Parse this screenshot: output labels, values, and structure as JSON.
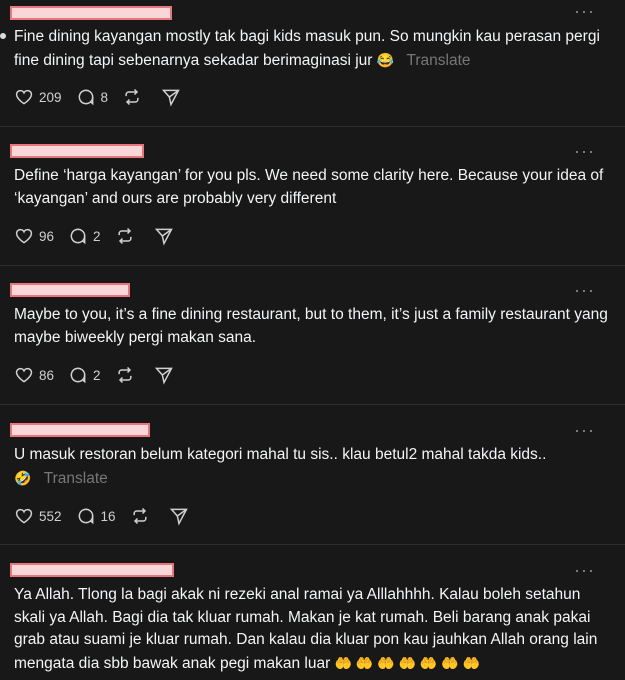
{
  "posts": [
    {
      "text": "Fine dining kayangan mostly tak bagi kids masuk pun. So mungkin kau perasan pergi fine dining tapi sebenarnya sekadar berimaginasi jur",
      "emoji": "😂",
      "translate": "Translate",
      "likes": "209",
      "replies": "8"
    },
    {
      "text": "Define ‘harga kayangan’ for you pls. We need some clarity here. Because your idea of ‘kayangan’ and ours are probably very different",
      "likes": "96",
      "replies": "2"
    },
    {
      "text": "Maybe to you, it’s a fine dining restaurant, but to them, it’s just a family restaurant yang maybe biweekly pergi makan sana.",
      "likes": "86",
      "replies": "2"
    },
    {
      "text": "U masuk restoran belum kategori mahal tu sis.. klau betul2 mahal takda kids..",
      "emoji": "🤣",
      "translate": "Translate",
      "likes": "552",
      "replies": "16"
    },
    {
      "text": "Ya Allah. Tlong la bagi akak ni rezeki anal ramai ya Alllahhhh. Kalau boleh setahun skali ya Allah. Bagi dia tak kluar rumah. Makan je kat rumah. Beli barang anak pakai grab atau suami je kluar rumah. Dan kalau dia kluar pon kau jauhkan Allah orang lain mengata dia sbb bawak anak pegi makan luar",
      "emoji": "🤲 🤲 🤲 🤲 🤲 🤲 🤲"
    }
  ],
  "more_glyph": "···"
}
